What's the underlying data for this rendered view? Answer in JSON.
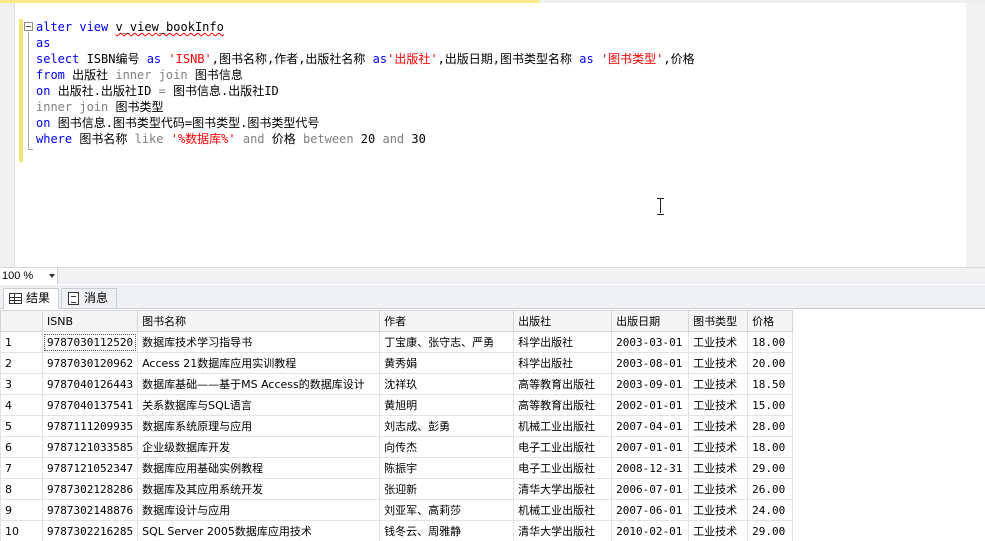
{
  "editor": {
    "lines": [
      [
        "kw:alter view ",
        "obj:v_view_bookInfo"
      ],
      [
        "kw:as"
      ],
      [
        "kw:select ",
        "txt:ISBN编号 ",
        "kw:as ",
        "str:'ISNB'",
        "txt:,图书名称,作者,出版社名称 ",
        "kw:as",
        "str:'出版社'",
        "txt:,出版日期,图书类型名称 ",
        "kw:as ",
        "str:'图书类型'",
        "txt:,价格"
      ],
      [
        "kw:from ",
        "txt:出版社 ",
        "gr:inner join ",
        "txt:图书信息"
      ],
      [
        "kw:on ",
        "txt:出版社.出版社ID ",
        "gr:= ",
        "txt:图书信息.出版社ID"
      ],
      [
        "gr:inner join ",
        "txt:图书类型"
      ],
      [
        "kw:on ",
        "txt:图书信息.图书类型代码=图书类型.图书类型代号"
      ],
      [
        "kw:where ",
        "txt:图书名称 ",
        "gr:like ",
        "str:'%数据库%' ",
        "gr:and ",
        "txt:价格 ",
        "gr:between ",
        "txt:20 ",
        "gr:and ",
        "txt:30"
      ]
    ]
  },
  "zoom": {
    "value": "100 %"
  },
  "tabs": {
    "results": "结果",
    "messages": "消息"
  },
  "grid": {
    "columns": [
      "ISNB",
      "图书名称",
      "作者",
      "出版社",
      "出版日期",
      "图书类型",
      "价格"
    ],
    "rows": [
      [
        "1",
        "9787030112520",
        "数据库技术学习指导书",
        "丁宝康、张守志、严勇",
        "科学出版社",
        "2003-03-01",
        "工业技术",
        "18.00"
      ],
      [
        "2",
        "9787030120962",
        "Access 21数据库应用实训教程",
        "黄秀娟",
        "科学出版社",
        "2003-08-01",
        "工业技术",
        "20.00"
      ],
      [
        "3",
        "9787040126443",
        "数据库基础——基于MS Access的数据库设计",
        "沈祥玖",
        "高等教育出版社",
        "2003-09-01",
        "工业技术",
        "18.50"
      ],
      [
        "4",
        "9787040137541",
        "关系数据库与SQL语言",
        "黄旭明",
        "高等教育出版社",
        "2002-01-01",
        "工业技术",
        "15.00"
      ],
      [
        "5",
        "9787111209935",
        "数据库系统原理与应用",
        "刘志成、彭勇",
        "机械工业出版社",
        "2007-04-01",
        "工业技术",
        "28.00"
      ],
      [
        "6",
        "9787121033585",
        "企业级数据库开发",
        "向传杰",
        "电子工业出版社",
        "2007-01-01",
        "工业技术",
        "18.00"
      ],
      [
        "7",
        "9787121052347",
        "数据库应用基础实例教程",
        "陈振宇",
        "电子工业出版社",
        "2008-12-31",
        "工业技术",
        "29.00"
      ],
      [
        "8",
        "9787302128286",
        "数据库及其应用系统开发",
        "张迎新",
        "清华大学出版社",
        "2006-07-01",
        "工业技术",
        "26.00"
      ],
      [
        "9",
        "9787302148876",
        "数据库设计与应用",
        "刘亚军、高莉莎",
        "机械工业出版社",
        "2007-06-01",
        "工业技术",
        "24.00"
      ],
      [
        "10",
        "9787302216285",
        "SQL Server 2005数据库应用技术",
        "钱冬云、周雅静",
        "清华大学出版社",
        "2010-02-01",
        "工业技术",
        "29.00"
      ]
    ]
  }
}
